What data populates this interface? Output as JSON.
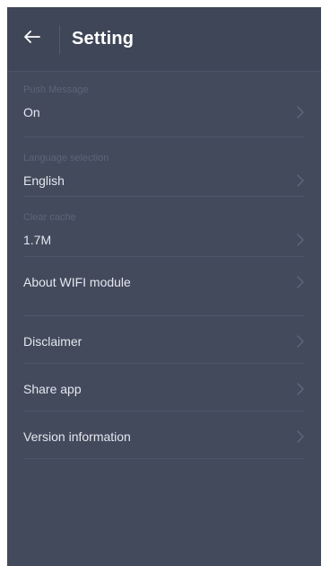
{
  "header": {
    "back_icon": "arrow-left-icon",
    "title": "Setting"
  },
  "settings": {
    "push_message": {
      "label": "Push Message",
      "value": "On"
    },
    "language": {
      "label": "Language selection",
      "value": "English"
    },
    "cache": {
      "label": "Clear cache",
      "value": "1.7M"
    },
    "about_wifi": {
      "value": "About WIFI module"
    },
    "disclaimer": {
      "value": "Disclaimer"
    },
    "share_app": {
      "value": "Share app"
    },
    "version": {
      "value": "Version information"
    }
  },
  "colors": {
    "background": "#434a5c",
    "text": "#e4e7ee",
    "caption": "#5c6477"
  }
}
